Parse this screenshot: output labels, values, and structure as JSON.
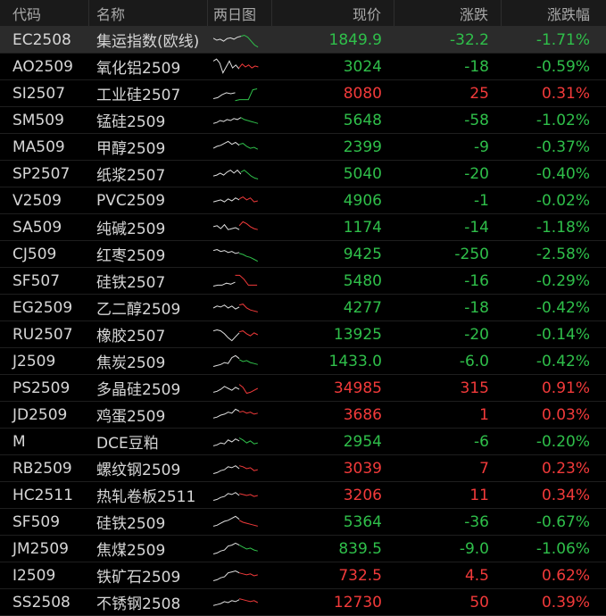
{
  "header": {
    "code": "代码",
    "name": "名称",
    "chart": "两日图",
    "price": "现价",
    "change": "涨跌",
    "pct": "涨跌幅"
  },
  "colors": {
    "up": "#f23a3a",
    "down": "#2fbf4a",
    "spark_prev": "#e0e0e0"
  },
  "rows": [
    {
      "code": "EC2508",
      "name": "集运指数(欧线)",
      "price": "1849.9",
      "change": "-32.2",
      "pct": "-1.71%",
      "dir": "down",
      "selected": true,
      "spark": [
        [
          0.4,
          0.5,
          0.45,
          0.55,
          0.42,
          0.38,
          0.45,
          0.35,
          0.3
        ],
        [
          0.3,
          0.25,
          0.35,
          0.55,
          0.75,
          0.85
        ]
      ],
      "spark_today_color": "down"
    },
    {
      "code": "AO2509",
      "name": "氧化铝2509",
      "price": "3024",
      "change": "-18",
      "pct": "-0.59%",
      "dir": "down",
      "spark": [
        [
          0.2,
          0.1,
          0.3,
          0.8,
          0.5,
          0.2,
          0.55,
          0.4,
          0.6
        ],
        [
          0.55,
          0.35,
          0.5,
          0.4,
          0.55,
          0.45,
          0.5
        ]
      ],
      "spark_today_color": "up"
    },
    {
      "code": "SI2507",
      "name": "工业硅2507",
      "price": "8080",
      "change": "25",
      "pct": "0.31%",
      "dir": "up",
      "spark": [
        [
          0.75,
          0.7,
          0.55,
          0.45,
          0.5,
          0.45
        ],
        [
          0.85,
          0.8,
          0.8,
          0.8,
          0.3,
          0.25
        ]
      ],
      "spark_today_color": "down"
    },
    {
      "code": "SM509",
      "name": "锰硅2509",
      "price": "5648",
      "change": "-58",
      "pct": "-1.02%",
      "dir": "down",
      "spark": [
        [
          0.65,
          0.6,
          0.5,
          0.55,
          0.45,
          0.5,
          0.4,
          0.45,
          0.35
        ],
        [
          0.35,
          0.45,
          0.5,
          0.55,
          0.6,
          0.65
        ]
      ],
      "spark_today_color": "down"
    },
    {
      "code": "MA509",
      "name": "甲醇2509",
      "price": "2399",
      "change": "-9",
      "pct": "-0.37%",
      "dir": "down",
      "spark": [
        [
          0.55,
          0.45,
          0.4,
          0.3,
          0.2,
          0.35,
          0.25,
          0.4
        ],
        [
          0.35,
          0.3,
          0.45,
          0.55,
          0.5,
          0.6
        ]
      ],
      "spark_today_color": "down"
    },
    {
      "code": "SP2507",
      "name": "纸浆2507",
      "price": "5040",
      "change": "-20",
      "pct": "-0.40%",
      "dir": "down",
      "spark": [
        [
          0.6,
          0.55,
          0.45,
          0.55,
          0.4,
          0.3,
          0.45,
          0.3,
          0.5
        ],
        [
          0.4,
          0.3,
          0.45,
          0.6,
          0.7,
          0.75
        ]
      ],
      "spark_today_color": "down"
    },
    {
      "code": "V2509",
      "name": "PVC2509",
      "price": "4906",
      "change": "-1",
      "pct": "-0.02%",
      "dir": "down",
      "spark": [
        [
          0.55,
          0.5,
          0.45,
          0.55,
          0.4,
          0.5,
          0.35,
          0.45
        ],
        [
          0.4,
          0.3,
          0.45,
          0.35,
          0.55,
          0.5
        ]
      ],
      "spark_today_color": "up"
    },
    {
      "code": "SA509",
      "name": "纯碱2509",
      "price": "1174",
      "change": "-14",
      "pct": "-1.18%",
      "dir": "down",
      "spark": [
        [
          0.45,
          0.4,
          0.55,
          0.35,
          0.6,
          0.55,
          0.5,
          0.6
        ],
        [
          0.4,
          0.2,
          0.3,
          0.45,
          0.55,
          0.6
        ]
      ],
      "spark_today_color": "up"
    },
    {
      "code": "CJ509",
      "name": "红枣2509",
      "price": "9425",
      "change": "-250",
      "pct": "-2.58%",
      "dir": "down",
      "spark": [
        [
          0.3,
          0.25,
          0.35,
          0.3,
          0.4,
          0.35,
          0.45,
          0.4
        ],
        [
          0.45,
          0.5,
          0.6,
          0.65,
          0.75,
          0.85
        ]
      ],
      "spark_today_color": "down"
    },
    {
      "code": "SF507",
      "name": "硅铁2507",
      "price": "5480",
      "change": "-16",
      "pct": "-0.29%",
      "dir": "down",
      "spark": [
        [
          0.75,
          0.7,
          0.7,
          0.6,
          0.65,
          0.55
        ],
        [
          0.2,
          0.2,
          0.4,
          0.7,
          0.7,
          0.7
        ]
      ],
      "spark_today_color": "up"
    },
    {
      "code": "EG2509",
      "name": "乙二醇2509",
      "price": "4277",
      "change": "-18",
      "pct": "-0.42%",
      "dir": "down",
      "spark": [
        [
          0.5,
          0.4,
          0.45,
          0.35,
          0.5,
          0.4,
          0.55,
          0.45
        ],
        [
          0.35,
          0.3,
          0.5,
          0.6,
          0.65,
          0.7
        ]
      ],
      "spark_today_color": "up"
    },
    {
      "code": "RU2507",
      "name": "橡胶2507",
      "price": "13925",
      "change": "-20",
      "pct": "-0.14%",
      "dir": "down",
      "spark": [
        [
          0.3,
          0.25,
          0.3,
          0.45,
          0.65,
          0.8,
          0.6,
          0.4
        ],
        [
          0.35,
          0.3,
          0.45,
          0.55,
          0.4,
          0.5
        ]
      ],
      "spark_today_color": "up"
    },
    {
      "code": "J2509",
      "name": "焦炭2509",
      "price": "1433.0",
      "change": "-6.0",
      "pct": "-0.42%",
      "dir": "down",
      "spark": [
        [
          0.75,
          0.7,
          0.65,
          0.55,
          0.6,
          0.3,
          0.2,
          0.35
        ],
        [
          0.4,
          0.5,
          0.45,
          0.55,
          0.6,
          0.65
        ]
      ],
      "spark_today_color": "down"
    },
    {
      "code": "PS2509",
      "name": "多晶硅2509",
      "price": "34985",
      "change": "315",
      "pct": "0.91%",
      "dir": "up",
      "spark": [
        [
          0.7,
          0.65,
          0.55,
          0.4,
          0.5,
          0.6,
          0.45,
          0.55
        ],
        [
          0.3,
          0.45,
          0.75,
          0.7,
          0.6,
          0.5
        ]
      ],
      "spark_today_color": "up"
    },
    {
      "code": "JD2509",
      "name": "鸡蛋2509",
      "price": "3686",
      "change": "1",
      "pct": "0.03%",
      "dir": "up",
      "spark": [
        [
          0.65,
          0.6,
          0.5,
          0.45,
          0.35,
          0.4,
          0.2,
          0.3
        ],
        [
          0.35,
          0.3,
          0.4,
          0.35,
          0.45,
          0.4
        ]
      ],
      "spark_today_color": "up"
    },
    {
      "code": "M",
      "name": "DCE豆粕",
      "price": "2954",
      "change": "-6",
      "pct": "-0.20%",
      "dir": "down",
      "spark": [
        [
          0.7,
          0.65,
          0.55,
          0.6,
          0.4,
          0.5,
          0.35,
          0.45
        ],
        [
          0.3,
          0.4,
          0.55,
          0.45,
          0.6,
          0.55
        ]
      ],
      "spark_today_color": "down"
    },
    {
      "code": "RB2509",
      "name": "螺纹钢2509",
      "price": "3039",
      "change": "7",
      "pct": "0.23%",
      "dir": "up",
      "spark": [
        [
          0.75,
          0.7,
          0.6,
          0.55,
          0.4,
          0.45,
          0.35,
          0.5
        ],
        [
          0.35,
          0.4,
          0.5,
          0.45,
          0.6,
          0.55
        ]
      ],
      "spark_today_color": "up"
    },
    {
      "code": "HC2511",
      "name": "热轧卷板2511",
      "price": "3206",
      "change": "11",
      "pct": "0.34%",
      "dir": "up",
      "spark": [
        [
          0.75,
          0.7,
          0.6,
          0.55,
          0.4,
          0.45,
          0.35,
          0.5
        ],
        [
          0.4,
          0.45,
          0.5,
          0.45,
          0.55,
          0.5
        ]
      ],
      "spark_today_color": "up"
    },
    {
      "code": "SF509",
      "name": "硅铁2509",
      "price": "5364",
      "change": "-36",
      "pct": "-0.67%",
      "dir": "down",
      "spark": [
        [
          0.7,
          0.65,
          0.55,
          0.45,
          0.4,
          0.3,
          0.2,
          0.35
        ],
        [
          0.4,
          0.5,
          0.55,
          0.6,
          0.65,
          0.7
        ]
      ],
      "spark_today_color": "up"
    },
    {
      "code": "JM2509",
      "name": "焦煤2509",
      "price": "839.5",
      "change": "-9.0",
      "pct": "-1.06%",
      "dir": "down",
      "spark": [
        [
          0.75,
          0.7,
          0.6,
          0.55,
          0.35,
          0.3,
          0.2,
          0.3
        ],
        [
          0.3,
          0.4,
          0.5,
          0.45,
          0.55,
          0.6
        ]
      ],
      "spark_today_color": "down"
    },
    {
      "code": "I2509",
      "name": "铁矿石2509",
      "price": "732.5",
      "change": "4.5",
      "pct": "0.62%",
      "dir": "up",
      "spark": [
        [
          0.75,
          0.7,
          0.6,
          0.55,
          0.35,
          0.3,
          0.25,
          0.35
        ],
        [
          0.35,
          0.4,
          0.45,
          0.4,
          0.5,
          0.45
        ]
      ],
      "spark_today_color": "up"
    },
    {
      "code": "SS2508",
      "name": "不锈钢2508",
      "price": "12730",
      "change": "50",
      "pct": "0.39%",
      "dir": "up",
      "spark": [
        [
          0.65,
          0.6,
          0.55,
          0.45,
          0.5,
          0.4,
          0.45,
          0.35
        ],
        [
          0.3,
          0.35,
          0.4,
          0.45,
          0.4,
          0.5
        ]
      ],
      "spark_today_color": "up"
    }
  ]
}
